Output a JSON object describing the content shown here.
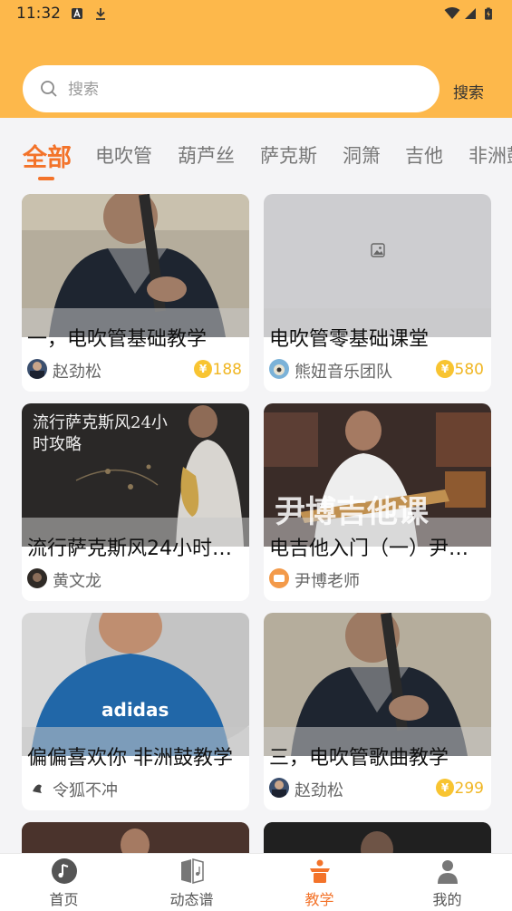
{
  "status_bar": {
    "time": "11:32"
  },
  "search": {
    "placeholder": "搜索",
    "value": "",
    "button_label": "搜索"
  },
  "tabs": [
    "全部",
    "电吹管",
    "葫芦丝",
    "萨克斯",
    "洞箫",
    "吉他",
    "非洲鼓"
  ],
  "active_tab": 0,
  "cards": [
    {
      "title": "一，电吹管基础教学",
      "author": "赵劲松",
      "price": "188"
    },
    {
      "title": "电吹管零基础课堂",
      "author": "熊妞音乐团队",
      "price": "580"
    },
    {
      "title": "流行萨克斯风24小时攻略",
      "author": "黄文龙",
      "price": "",
      "thumb_text": "流行萨克斯风24小时攻略"
    },
    {
      "title": "电吉他入门（一）尹博吉他课",
      "author": "尹博老师",
      "price": "",
      "thumb_text": "尹博吉他课"
    },
    {
      "title": "偏偏喜欢你 非洲鼓教学",
      "author": "令狐不冲",
      "price": "",
      "thumb_text": "adidas"
    },
    {
      "title": "三，电吹管歌曲教学",
      "author": "赵劲松",
      "price": "299"
    }
  ],
  "coin_symbol": "¥",
  "nav": [
    {
      "label": "首页",
      "icon": "music-note-icon"
    },
    {
      "label": "动态谱",
      "icon": "sheet-music-icon"
    },
    {
      "label": "教学",
      "icon": "lectern-icon"
    },
    {
      "label": "我的",
      "icon": "person-icon"
    }
  ],
  "active_nav": 2,
  "colors": {
    "header": "#fdb84b",
    "accent": "#f3732a",
    "price": "#f0b623"
  }
}
